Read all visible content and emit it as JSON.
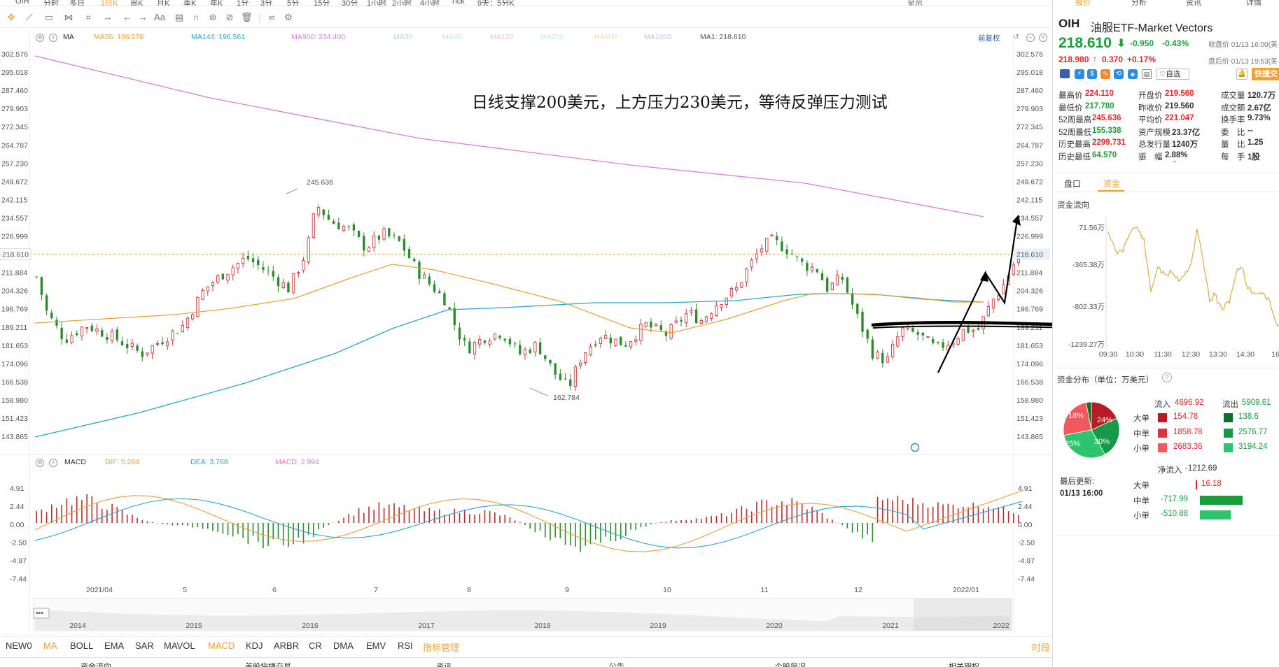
{
  "top_timeframes": [
    "OIH",
    "分时",
    "多日",
    "1日K",
    "周K",
    "月K",
    "季K",
    "年K",
    "1分",
    "3分",
    "5分",
    "15分",
    "30分",
    "1小时",
    "2小时",
    "4小时",
    "Tick",
    "9天：5分K"
  ],
  "top_right": {
    "display_label": "显示"
  },
  "ma_legend": {
    "label": "MA",
    "ma55": "MA55: 196.576",
    "ma144": "MA144: 196.561",
    "ma900": "MA900: 234.400",
    "ma30": "MA30",
    "ma60": "MA60",
    "ma120": "MA120",
    "ma250": "MA250",
    "ma500": "MA500",
    "ma1000": "MA1000",
    "ma1": "MA1: 218.610",
    "fq": "前复权"
  },
  "annotation": "日线支撑200美元，上方压力230美元，等待反弹压力测试",
  "price_axis": [
    "302.576",
    "295.018",
    "287.460",
    "279.903",
    "272.345",
    "264.787",
    "257.230",
    "249.672",
    "242.115",
    "234.557",
    "226.999",
    "218.610",
    "211.884",
    "204.326",
    "196.769",
    "189.211",
    "181.653",
    "174.096",
    "166.538",
    "158.980",
    "151.423",
    "143.865"
  ],
  "current_price_tag": "218.610",
  "high_marker": "245.636",
  "low_marker": "162.784",
  "macd_legend": {
    "label": "MACD",
    "dif": "DIF: 5.264",
    "dea": "DEA: 3.768",
    "macd": "MACD: 2.994"
  },
  "macd_axis": [
    "4.91",
    "2.44",
    "0.00",
    "-2.50",
    "-4.97",
    "-7.44"
  ],
  "time_axis": [
    "2021/04",
    "5",
    "6",
    "7",
    "8",
    "9",
    "10",
    "11",
    "12",
    "2022/01"
  ],
  "overview_years": [
    "2014",
    "2015",
    "2016",
    "2017",
    "2018",
    "2019",
    "2020",
    "2021",
    "2022"
  ],
  "overview_dots": "•••",
  "indicators": [
    "NEW0",
    "MA",
    "BOLL",
    "EMA",
    "SAR",
    "MAVOL",
    "MACD",
    "KDJ",
    "ARBR",
    "CR",
    "DMA",
    "EMV",
    "RSI",
    "指标管理"
  ],
  "indicator_right": "时段",
  "bottom_tabs": [
    "资金流向",
    "美股快捷交易",
    "资讯",
    "公告",
    "个股简况",
    "相关期权"
  ],
  "right_panel": {
    "tabs": [
      "报价",
      "分析",
      "资讯",
      "详情"
    ],
    "symbol": "OIH",
    "name": "油服ETF-Market Vectors",
    "price": "218.610",
    "arrow": "⬇",
    "change": "-0.950",
    "change_pct": "-0.43%",
    "close_time": "收盘价 01/13 16:00(美",
    "after_price": "218.980",
    "after_arrow": "↑",
    "after_change": "0.370",
    "after_pct": "+0.17%",
    "after_time": "盘后价 01/13 19:53(美",
    "self_select": "自选",
    "quick_trade": "快捷交",
    "stats": [
      [
        {
          "k": "最高价",
          "v": "224.110",
          "c": "red"
        },
        {
          "k": "开盘价",
          "v": "219.560",
          "c": "red"
        },
        {
          "k": "成交量",
          "v": "120.7万",
          "c": ""
        }
      ],
      [
        {
          "k": "最低价",
          "v": "217.780",
          "c": "green"
        },
        {
          "k": "昨收价",
          "v": "219.560",
          "c": ""
        },
        {
          "k": "成交额",
          "v": "2.67亿",
          "c": ""
        }
      ],
      [
        {
          "k": "52周最高",
          "v": "245.636",
          "c": "red"
        },
        {
          "k": "平均价",
          "v": "221.047",
          "c": "red"
        },
        {
          "k": "换手率",
          "v": "9.73%",
          "c": ""
        }
      ],
      [
        {
          "k": "52周最低",
          "v": "155.338",
          "c": "green"
        },
        {
          "k": "资产规模",
          "v": "23.37亿",
          "c": ""
        },
        {
          "k": "委　比",
          "v": "--",
          "c": ""
        }
      ],
      [
        {
          "k": "历史最高",
          "v": "2299.731",
          "c": "red"
        },
        {
          "k": "总发行量",
          "v": "1240万",
          "c": ""
        },
        {
          "k": "量　比",
          "v": "1.25",
          "c": ""
        }
      ],
      [
        {
          "k": "历史最低",
          "v": "64.570",
          "c": "green"
        },
        {
          "k": "振　幅",
          "v": "2.88%",
          "c": ""
        },
        {
          "k": "每　手",
          "v": "1股",
          "c": ""
        }
      ]
    ],
    "sub_tabs": [
      "盘口",
      "资金"
    ],
    "flow_title": "资金流向",
    "flow_y": [
      "71.56万",
      "-365.38万",
      "-802.33万",
      "-1239.27万"
    ],
    "flow_x": [
      "09:30",
      "10:30",
      "11:30",
      "12:30",
      "13:30",
      "14:30",
      "16"
    ],
    "dist_title": "资金分布（单位：万美元）",
    "pie": {
      "labels": [
        "18%",
        "24%",
        "25%",
        "30%"
      ]
    },
    "in_label": "流入",
    "in_total": "4696.92",
    "out_label": "流出",
    "out_total": "5909.61",
    "rows": [
      {
        "name": "大单",
        "in": "154.78",
        "out": "138.6"
      },
      {
        "name": "中单",
        "in": "1858.78",
        "out": "2576.77"
      },
      {
        "name": "小单",
        "in": "2683.36",
        "out": "3194.24"
      }
    ],
    "last_update_label": "最后更新:",
    "last_update": "01/13 16:00",
    "net_label": "净流入",
    "net_total": "-1212.69",
    "net_rows": [
      {
        "name": "大单",
        "v": "16.18",
        "pos": 1,
        "frac": 0.01
      },
      {
        "name": "中单",
        "v": "-717.99",
        "pos": 0,
        "frac": 0.55
      },
      {
        "name": "小单",
        "v": "-510.88",
        "pos": 0,
        "frac": 0.4
      }
    ]
  },
  "colors": {
    "up": "#e4272a",
    "down": "#1a9d3b",
    "accent": "#e8a33a",
    "ma55": "#e6a13c",
    "ma144": "#2aa6c9",
    "ma900": "#d780d8"
  }
}
